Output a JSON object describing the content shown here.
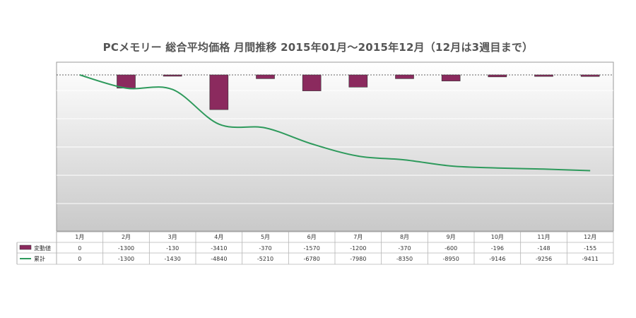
{
  "chart_data": {
    "type": "bar",
    "title": "PCメモリー 総合平均価格 月間推移  2015年01月～2015年12月（12月は3週目まで）",
    "categories": [
      "1月",
      "2月",
      "3月",
      "4月",
      "5月",
      "6月",
      "7月",
      "8月",
      "9月",
      "10月",
      "11月",
      "12月"
    ],
    "series": [
      {
        "name": "変動値",
        "type": "bar",
        "color": "#8b2a5e",
        "values": [
          0,
          -1300,
          -130,
          -3410,
          -370,
          -1570,
          -1200,
          -370,
          -600,
          -196,
          -148,
          -155
        ]
      },
      {
        "name": "累計",
        "type": "line",
        "color": "#2e9a5c",
        "values": [
          0,
          -1300,
          -1430,
          -4840,
          -5210,
          -6780,
          -7980,
          -8350,
          -8950,
          -9146,
          -9256,
          -9411
        ]
      }
    ],
    "ylim": [
      -11000,
      500
    ],
    "grid": true,
    "legend": "table-left",
    "background_gradient": [
      "#ffffff",
      "#c8c8c8"
    ]
  }
}
